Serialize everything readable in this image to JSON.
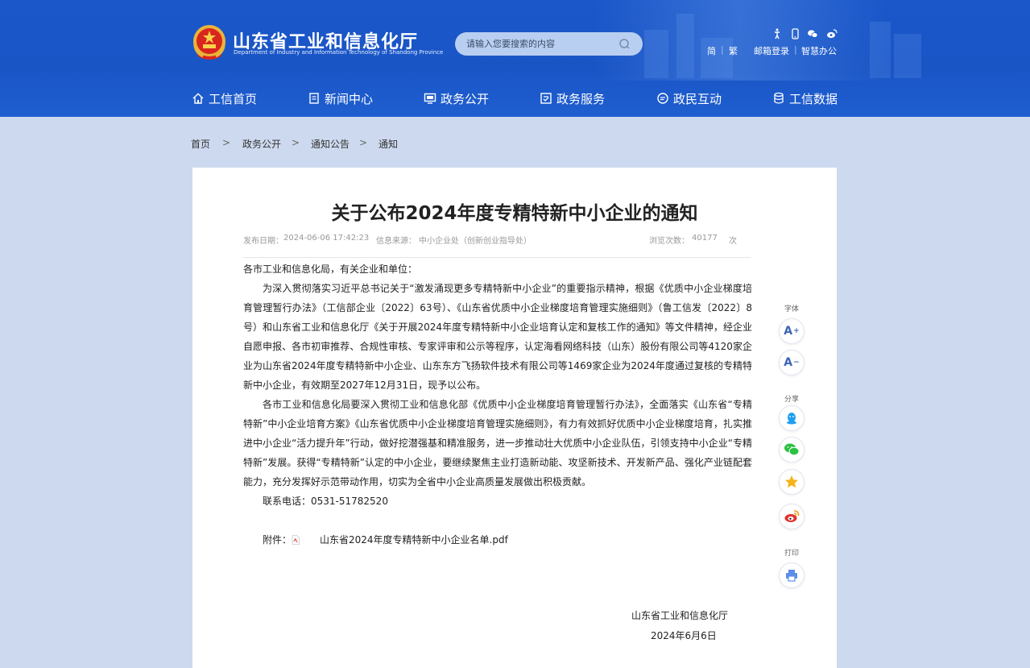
{
  "header": {
    "site_title": "山东省工业和信息化厅",
    "site_subtitle": "Department of Industry and Information Technology of Shandong Province",
    "emblem_icon": "national-emblem-icon",
    "search": {
      "placeholder": "请输入您要搜索的内容",
      "icon": "search-icon"
    },
    "top_icons": [
      "accessibility-icon",
      "mobile-icon",
      "wechat-icon",
      "weibo-icon"
    ],
    "top_links": {
      "simplified": "简",
      "traditional": "繁",
      "mail_login": "邮箱登录",
      "smart_office": "智慧办公"
    }
  },
  "nav": {
    "items": [
      {
        "label": "工信首页",
        "icon": "home-icon"
      },
      {
        "label": "新闻中心",
        "icon": "document-icon"
      },
      {
        "label": "政务公开",
        "icon": "monitor-icon"
      },
      {
        "label": "政务服务",
        "icon": "service-icon"
      },
      {
        "label": "政民互动",
        "icon": "chat-icon"
      },
      {
        "label": "工信数据",
        "icon": "database-icon"
      }
    ]
  },
  "breadcrumb": {
    "items": [
      "首页",
      "政务公开",
      "通知公告",
      "通知"
    ],
    "separator": ">"
  },
  "article": {
    "title": "关于公布2024年度专精特新中小企业的通知",
    "meta": {
      "date_label": "发布日期：",
      "date": "2024-06-06 17:42:23",
      "source_label": "信息来源：",
      "source": "中小企业处（创新创业指导处）",
      "views_label": "浏览次数：",
      "views": "40177",
      "views_unit": "次"
    },
    "salutation": "各市工业和信息化局，有关企业和单位：",
    "paragraphs": [
      "为深入贯彻落实习近平总书记关于“激发涌现更多专精特新中小企业”的重要指示精神，根据《优质中小企业梯度培育管理暂行办法》（工信部企业〔2022〕63号）、《山东省优质中小企业梯度培育管理实施细则》（鲁工信发〔2022〕8号）和山东省工业和信息化厅《关于开展2024年度专精特新中小企业培育认定和复核工作的通知》等文件精神，经企业自愿申报、各市初审推荐、合规性审核、专家评审和公示等程序，认定海看网络科技（山东）股份有限公司等4120家企业为山东省2024年度专精特新中小企业、山东东方飞扬软件技术有限公司等1469家企业为2024年度通过复核的专精特新中小企业，有效期至2027年12月31日，现予以公布。",
      "各市工业和信息化局要深入贯彻工业和信息化部《优质中小企业梯度培育管理暂行办法》，全面落实《山东省“专精特新”中小企业培育方案》《山东省优质中小企业梯度培育管理实施细则》，有力有效抓好优质中小企业梯度培育，扎实推进中小企业“活力提升年”行动，做好挖潜强基和精准服务，进一步推动壮大优质中小企业队伍，引领支持中小企业“专精特新”发展。获得“专精特新”认定的中小企业，要继续聚焦主业打造新动能、攻坚新技术、开发新产品、强化产业链配套能力，充分发挥好示范带动作用，切实为全省中小企业高质量发展做出积极贡献。"
    ],
    "contact": "联系电话：0531-51782520",
    "attachment_label": "附件：",
    "attachment_name": "山东省2024年度专精特新中小企业名单.pdf",
    "signature": "山东省工业和信息化厅",
    "sign_date": "2024年6月6日"
  },
  "tools": {
    "font_label": "字体",
    "font_increase": "A",
    "font_decrease": "A",
    "share_label": "分享",
    "share_icons": [
      "qq-icon",
      "wechat-share-icon",
      "qzone-star-icon",
      "weibo-share-icon"
    ],
    "print_label": "打印",
    "print_icon": "printer-icon"
  },
  "colors": {
    "header_blue": "#1b57c9",
    "page_bg": "#cdd9ef",
    "qq": "#1fa0f0",
    "wechat": "#2cc140",
    "star": "#f6b21a",
    "weibo": "#e2342b",
    "print": "#5a8ee8"
  }
}
